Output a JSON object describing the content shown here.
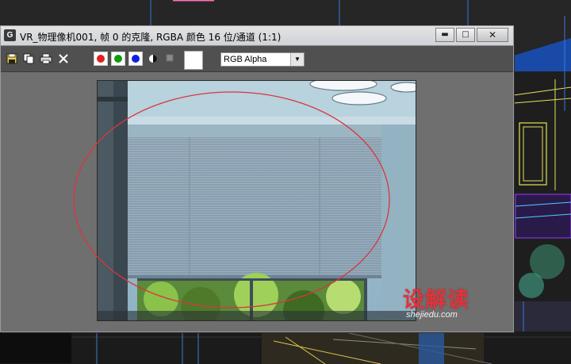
{
  "window": {
    "title": "VR_物理像机001, 帧 0 的克隆, RGBA 颜色 16 位/通道 (1:1)",
    "app_icon": "G",
    "minimize_label": "▬",
    "maximize_label": "□",
    "close_label": "✕"
  },
  "toolbar": {
    "channel_select": {
      "selected": "RGB Alpha",
      "arrow": "▼"
    },
    "channel_colors": {
      "red": "#e02020",
      "green": "#109a10",
      "blue": "#1020e0"
    }
  },
  "watermark": {
    "brand": "设解读",
    "url": "shejiedu.com"
  },
  "colors": {
    "highlight_ellipse": "#d9363e",
    "viewport_wire": "#2f6fd6"
  }
}
